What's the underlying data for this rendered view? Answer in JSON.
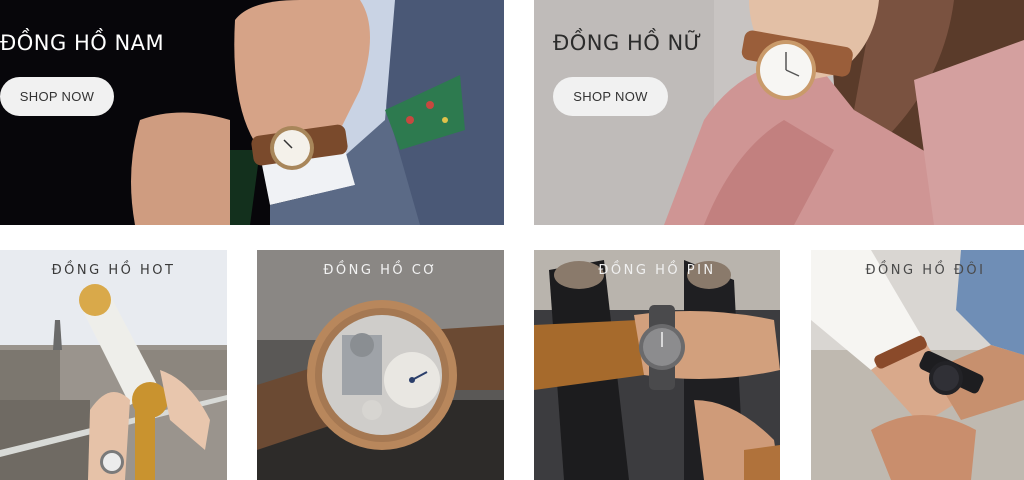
{
  "banners": {
    "men": {
      "title": "ĐỒNG HỒ NAM",
      "button": "SHOP NOW"
    },
    "women": {
      "title": "ĐỒNG HỒ NỮ",
      "button": "SHOP NOW"
    }
  },
  "categories": [
    {
      "title": "ĐỒNG HỒ HOT"
    },
    {
      "title": "ĐỒNG HỒ CƠ"
    },
    {
      "title": "ĐỒNG HỒ PIN"
    },
    {
      "title": "ĐỒNG HỒ ĐÔI"
    }
  ],
  "colors": {
    "button_bg": "#f1f1f1",
    "button_text": "#333333",
    "men_bg": "#07060a",
    "women_bg": "#c9c6c4"
  }
}
